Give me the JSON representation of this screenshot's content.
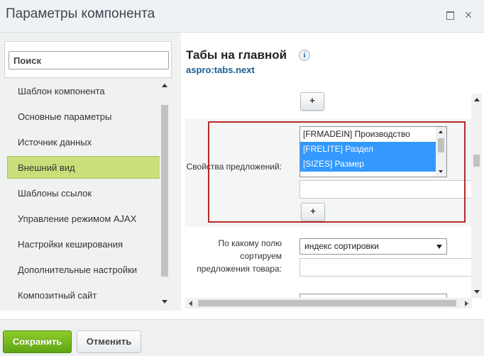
{
  "window": {
    "title": "Параметры компонента"
  },
  "sidebar": {
    "search_placeholder": "Поиск",
    "items": [
      {
        "label": "Шаблон компонента"
      },
      {
        "label": "Основные параметры"
      },
      {
        "label": "Источник данных"
      },
      {
        "label": "Внешний вид",
        "active": true
      },
      {
        "label": "Шаблоны ссылок"
      },
      {
        "label": "Управление режимом AJAX"
      },
      {
        "label": "Настройки кеширования"
      },
      {
        "label": "Дополнительные настройки"
      },
      {
        "label": "Композитный сайт"
      }
    ]
  },
  "component": {
    "title": "Табы на главной",
    "code": "aspro:tabs.next",
    "info_icon": "i"
  },
  "properties": {
    "add_label": "+",
    "offers": {
      "label": "Свойства предложений:",
      "options": [
        {
          "text": "[FRMADEIN] Производство",
          "selected": false
        },
        {
          "text": "[FRELITE] Раздел",
          "selected": true
        },
        {
          "text": "[SIZES] Размер",
          "selected": true
        }
      ],
      "text_value": ""
    },
    "sort": {
      "label": "По какому полю сортируем предложения товара:",
      "selected": "индекс сортировки",
      "text_value": ""
    }
  },
  "footer": {
    "save_label": "Сохранить",
    "cancel_label": "Отменить"
  },
  "colors": {
    "active_item": "#c8df7a",
    "save_button": "#6fb51d",
    "selection": "#3399ff",
    "highlight_border": "#b52a2a",
    "code_text": "#1a5d8f"
  }
}
